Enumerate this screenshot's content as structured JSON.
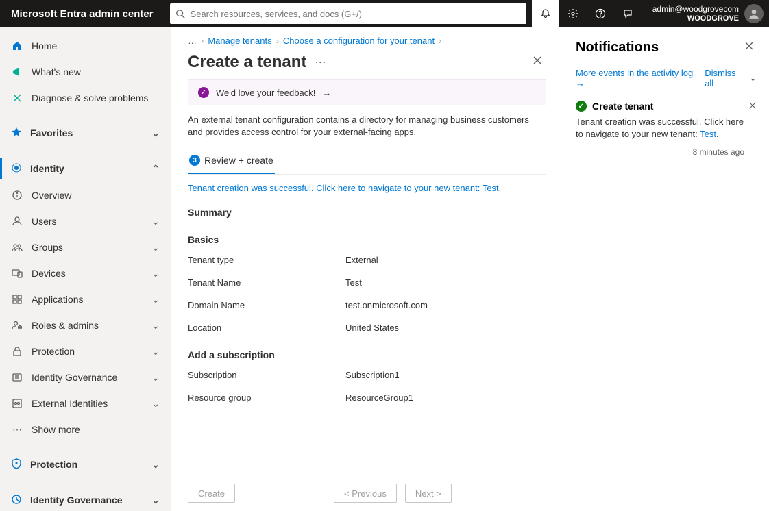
{
  "header": {
    "app_title": "Microsoft Entra admin center",
    "search_placeholder": "Search resources, services, and docs (G+/)",
    "user_email": "admin@woodgrovecom",
    "user_org": "WOODGROVE"
  },
  "sidebar": {
    "home": "Home",
    "whats_new": "What's new",
    "diagnose": "Diagnose & solve problems",
    "favorites": "Favorites",
    "identity": "Identity",
    "identity_items": {
      "overview": "Overview",
      "users": "Users",
      "groups": "Groups",
      "devices": "Devices",
      "applications": "Applications",
      "roles": "Roles & admins",
      "protection": "Protection",
      "governance": "Identity Governance",
      "external": "External Identities",
      "show_more": "Show more"
    },
    "protection_section": "Protection",
    "governance_section": "Identity Governance"
  },
  "breadcrumbs": {
    "more": "…",
    "manage": "Manage tenants",
    "choose": "Choose a configuration for your tenant"
  },
  "page": {
    "title": "Create a tenant",
    "feedback": "We'd love your feedback!",
    "description": "An external tenant configuration contains a directory for managing business customers and provides access control for your external-facing apps.",
    "tab_label": "Review + create",
    "tab_badge": "3",
    "success_msg_prefix": "Tenant creation was successful. Click here to navigate to your new tenant: ",
    "success_link_text": "Test",
    "success_msg_suffix": ".",
    "summary_h": "Summary",
    "basics_h": "Basics",
    "basics": {
      "tenant_type_k": "Tenant type",
      "tenant_type_v": "External",
      "tenant_name_k": "Tenant Name",
      "tenant_name_v": "Test",
      "domain_k": "Domain Name",
      "domain_v": "test.onmicrosoft.com",
      "location_k": "Location",
      "location_v": "United States"
    },
    "sub_h": "Add a subscription",
    "sub": {
      "subscription_k": "Subscription",
      "subscription_v": "Subscription1",
      "rg_k": "Resource group",
      "rg_v": "ResourceGroup1"
    },
    "buttons": {
      "create": "Create",
      "previous": "< Previous",
      "next": "Next >"
    }
  },
  "notifications": {
    "title": "Notifications",
    "more_events": "More events in the activity log →",
    "dismiss_all": "Dismiss all",
    "item": {
      "title": "Create tenant",
      "body_prefix": "Tenant creation was successful. Click here to navigate to your new tenant: ",
      "link": "Test",
      "body_suffix": ".",
      "time": "8 minutes ago"
    }
  }
}
